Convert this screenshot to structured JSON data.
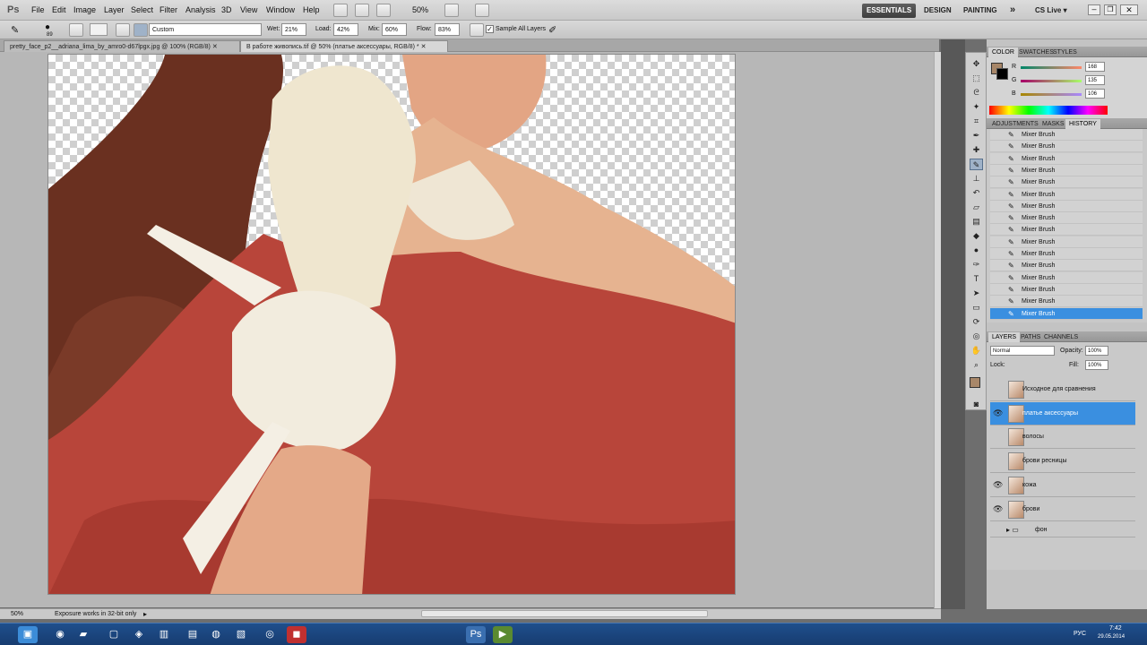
{
  "app": {
    "logo": "Ps"
  },
  "menu": [
    "File",
    "Edit",
    "Image",
    "Layer",
    "Select",
    "Filter",
    "Analysis",
    "3D",
    "View",
    "Window",
    "Help"
  ],
  "zoom_display": "50%",
  "workspaces": {
    "essentials": "ESSENTIALS",
    "design": "DESIGN",
    "painting": "PAINTING",
    "more": "»",
    "cslive": "CS Live ▾"
  },
  "options_bar": {
    "brush_size": "89",
    "preset": "Custom",
    "wet_label": "Wet:",
    "wet_value": "21%",
    "load_label": "Load:",
    "load_value": "42%",
    "mix_label": "Mix:",
    "mix_value": "60%",
    "flow_label": "Flow:",
    "flow_value": "83%",
    "sample_label": "Sample All Layers"
  },
  "tabs": [
    {
      "label": "pretty_face_p2__adriana_lima_by_amro0-d67lpgx.jpg @ 100% (RGB/8)",
      "active": false
    },
    {
      "label": "В работе живопись.tif @ 50% (платье аксессуары, RGB/8) *",
      "active": true
    }
  ],
  "status": {
    "zoom": "50%",
    "message": "Exposure works in 32-bit only"
  },
  "color_panel": {
    "tabs": [
      "COLOR",
      "SWATCHES",
      "STYLES"
    ],
    "r_label": "R",
    "r_value": "168",
    "g_label": "G",
    "g_value": "135",
    "b_label": "B",
    "b_value": "106",
    "fg_color": "#a88769"
  },
  "history_panel": {
    "tabs": [
      "ADJUSTMENTS",
      "MASKS",
      "HISTORY"
    ],
    "items": [
      "Mixer Brush",
      "Mixer Brush",
      "Mixer Brush",
      "Mixer Brush",
      "Mixer Brush",
      "Mixer Brush",
      "Mixer Brush",
      "Mixer Brush",
      "Mixer Brush",
      "Mixer Brush",
      "Mixer Brush",
      "Mixer Brush",
      "Mixer Brush",
      "Mixer Brush",
      "Mixer Brush",
      "Mixer Brush"
    ],
    "selected_index": 15
  },
  "layers_panel": {
    "tabs": [
      "LAYERS",
      "PATHS",
      "CHANNELS"
    ],
    "blend_mode": "Normal",
    "opacity_label": "Opacity:",
    "opacity_value": "100%",
    "lock_label": "Lock:",
    "fill_label": "Fill:",
    "fill_value": "100%",
    "layers": [
      {
        "name": "Исходное для сравнения",
        "visible": false,
        "selected": false
      },
      {
        "name": "платье аксессуары",
        "visible": true,
        "selected": true
      },
      {
        "name": "волосы",
        "visible": false,
        "selected": false
      },
      {
        "name": "брови ресницы",
        "visible": false,
        "selected": false
      },
      {
        "name": "кожа",
        "visible": true,
        "selected": false
      },
      {
        "name": "брови",
        "visible": true,
        "selected": false
      }
    ],
    "group": {
      "name": "фон"
    }
  },
  "taskbar": {
    "lang": "РУС",
    "time": "7:42",
    "date": "29.05.2014"
  }
}
